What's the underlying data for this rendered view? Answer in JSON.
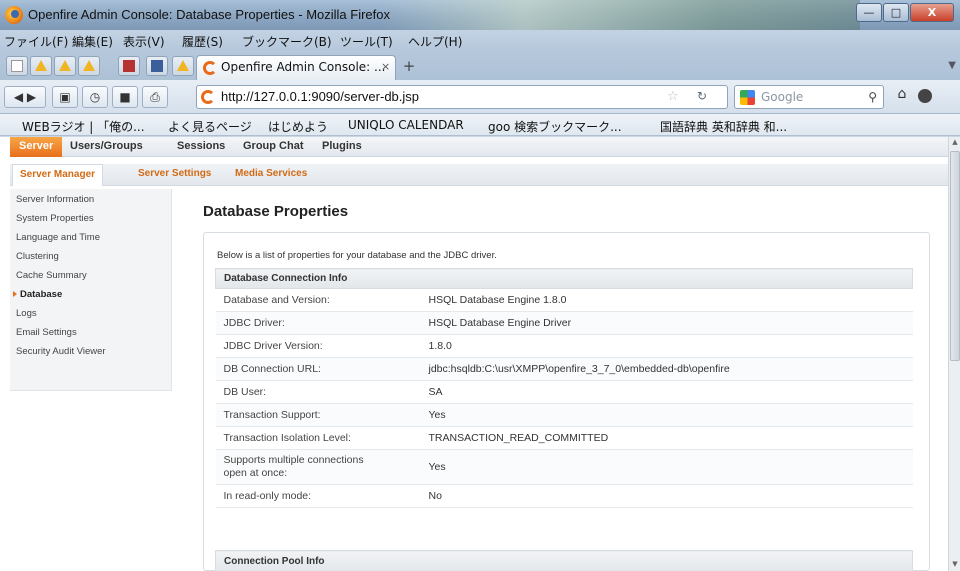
{
  "window": {
    "title": "Openfire Admin Console: Database Properties - Mozilla Firefox"
  },
  "menubar": [
    "ファイル(F)",
    "編集(E)",
    "表示(V)",
    "履歴(S)",
    "ブックマーク(B)",
    "ツール(T)",
    "ヘルプ(H)"
  ],
  "tabs": {
    "active_label": "Openfire Admin Console: ...",
    "close_glyph": "×",
    "new_tab_glyph": "+"
  },
  "navbar": {
    "back": "◀▶",
    "url": "http://127.0.0.1:9090/server-db.jsp",
    "search_placeholder": "Google"
  },
  "bookmarks": [
    "WEBラジオ | 「俺の...",
    "よく見るページ",
    "はじめよう",
    "UNIQLO CALENDAR",
    "goo 検索ブックマーク...",
    "国語辞典 英和辞典 和..."
  ],
  "main_tabs": [
    "Server",
    "Users/Groups",
    "Sessions",
    "Group Chat",
    "Plugins"
  ],
  "sub_tabs": [
    "Server Manager",
    "Server Settings",
    "Media Services"
  ],
  "sidebar": [
    "Server Information",
    "System Properties",
    "Language and Time",
    "Clustering",
    "Cache Summary",
    "Database",
    "Logs",
    "Email Settings",
    "Security Audit Viewer"
  ],
  "page": {
    "title": "Database Properties",
    "intro": "Below is a list of properties for your database and the JDBC driver."
  },
  "connection_info": {
    "header": "Database Connection Info",
    "rows": [
      {
        "label": "Database and Version:",
        "value": "HSQL Database Engine 1.8.0"
      },
      {
        "label": "JDBC Driver:",
        "value": "HSQL Database Engine Driver"
      },
      {
        "label": "JDBC Driver Version:",
        "value": "1.8.0"
      },
      {
        "label": "DB Connection URL:",
        "value": "jdbc:hsqldb:C:\\usr\\XMPP\\openfire_3_7_0\\embedded-db\\openfire"
      },
      {
        "label": "DB User:",
        "value": "SA"
      },
      {
        "label": "Transaction Support:",
        "value": "Yes"
      },
      {
        "label": "Transaction Isolation Level:",
        "value": "TRANSACTION_READ_COMMITTED"
      },
      {
        "label": "Supports multiple connections open at once:",
        "value": "Yes"
      },
      {
        "label": "In read-only mode:",
        "value": "No"
      }
    ]
  },
  "pool_info": {
    "header": "Connection Pool Info"
  }
}
